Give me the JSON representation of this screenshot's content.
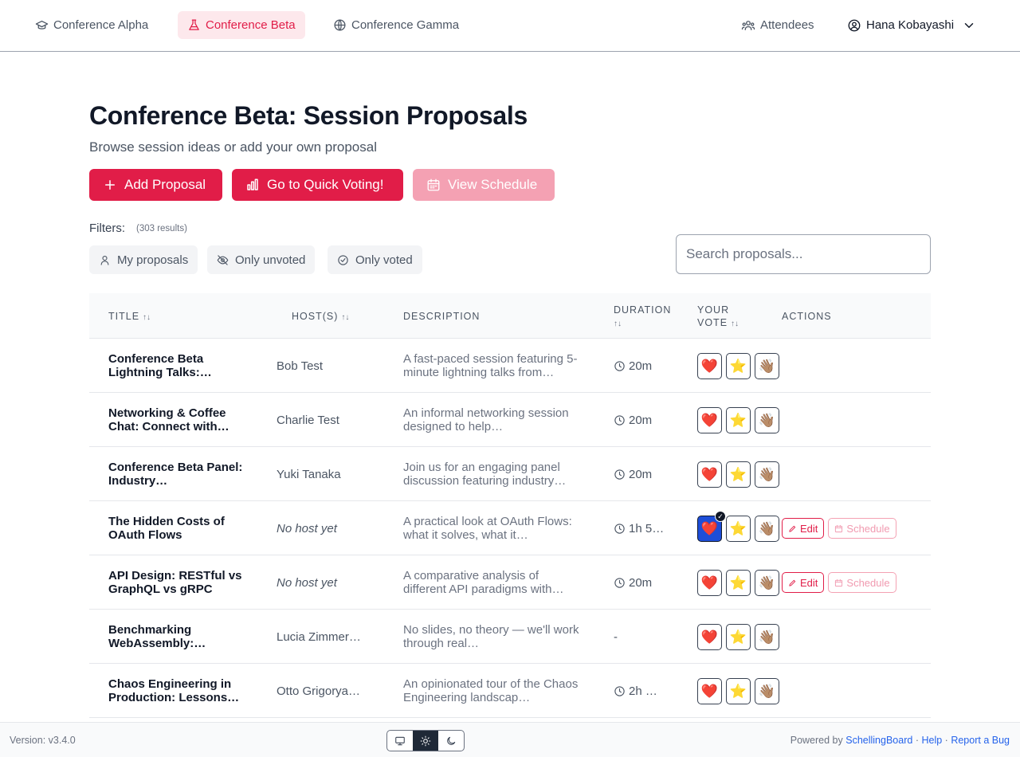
{
  "nav": {
    "tabs": [
      {
        "label": "Conference Alpha",
        "icon": "graduation-cap-icon"
      },
      {
        "label": "Conference Beta",
        "icon": "flask-icon",
        "active": true
      },
      {
        "label": "Conference Gamma",
        "icon": "globe-icon"
      }
    ],
    "attendees_label": "Attendees",
    "user_name": "Hana Kobayashi"
  },
  "page": {
    "title": "Conference Beta: Session Proposals",
    "subtitle": "Browse session ideas or add your own proposal",
    "buttons": {
      "add": "Add Proposal",
      "vote": "Go to Quick Voting!",
      "schedule": "View Schedule"
    }
  },
  "filters": {
    "label": "Filters:",
    "count": "(303 results)",
    "chips": [
      "My proposals",
      "Only unvoted",
      "Only voted"
    ],
    "search_placeholder": "Search proposals..."
  },
  "table": {
    "headers": {
      "title": "TITLE",
      "hosts": "HOST(S)",
      "description": "DESCRIPTION",
      "duration_1": "DURATION",
      "vote_1": "YOUR",
      "vote_2": "VOTE",
      "actions": "ACTIONS",
      "sort_glyph": "↑↓"
    },
    "vote_emojis": [
      "❤️",
      "⭐",
      "👋🏽"
    ],
    "action_labels": {
      "edit": "Edit",
      "schedule": "Schedule"
    },
    "rows": [
      {
        "title": "Conference Beta Lightning Talks:…",
        "host": "Bob Test",
        "description": "A fast-paced session featuring 5-minute lightning talks from…",
        "duration": "20m"
      },
      {
        "title": "Networking & Coffee Chat: Connect with…",
        "host": "Charlie Test",
        "description": "An informal networking session designed to help…",
        "duration": "20m"
      },
      {
        "title": "Conference Beta Panel: Industry…",
        "host": "Yuki Tanaka",
        "description": "Join us for an engaging panel discussion featuring industry…",
        "duration": "20m"
      },
      {
        "title": "The Hidden Costs of OAuth Flows",
        "host": "No host yet",
        "description": "A practical look at OAuth Flows: what it solves, what it…",
        "duration": "1h 5…",
        "voted": "heart",
        "editable": true
      },
      {
        "title": "API Design: RESTful vs GraphQL vs gRPC",
        "host": "No host yet",
        "description": "A comparative analysis of different API paradigms with…",
        "duration": "20m",
        "editable": true
      },
      {
        "title": "Benchmarking WebAssembly:…",
        "host": "Lucia Zimmer…",
        "description": "No slides, no theory — we'll work through real…",
        "duration": "-"
      },
      {
        "title": "Chaos Engineering in Production: Lessons…",
        "host": "Otto Grigorya…",
        "description": "An opinionated tour of the Chaos Engineering landscap…",
        "duration": "2h …"
      }
    ]
  },
  "footer": {
    "version": "Version: v3.4.0",
    "powered_by": "Powered by",
    "brand_link": "SchellingBoard",
    "help_link": "Help",
    "bug_link": "Report a Bug",
    "separator": "·",
    "theme_modes": [
      "monitor-icon",
      "sun-icon",
      "moon-icon"
    ],
    "active_theme": "sun-icon"
  },
  "colors": {
    "accent": "#e11d48",
    "accent_light": "#f4a1b3",
    "active_tab_bg": "#fde8ec",
    "selected_vote": "#1d4ed8",
    "link": "#2563eb"
  }
}
